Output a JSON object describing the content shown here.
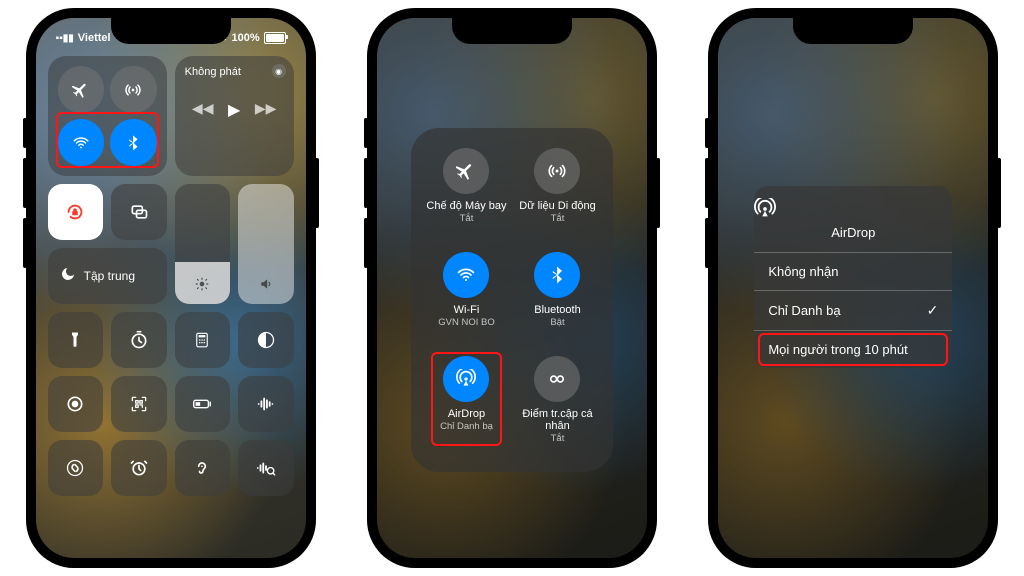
{
  "status": {
    "carrier": "Viettel",
    "battery_pct": "100%"
  },
  "phone1": {
    "media_title": "Không phát",
    "focus_label": "Tập trung"
  },
  "conn_panel": {
    "airplane": {
      "label": "Chế độ Máy bay",
      "sub": "Tắt"
    },
    "cellular": {
      "label": "Dữ liệu Di động",
      "sub": "Tắt"
    },
    "wifi": {
      "label": "Wi-Fi",
      "sub": "GVN NOI BO"
    },
    "bluetooth": {
      "label": "Bluetooth",
      "sub": "Bật"
    },
    "airdrop": {
      "label": "AirDrop",
      "sub": "Chỉ Danh bạ"
    },
    "hotspot": {
      "label": "Điểm tr.cập cá nhân",
      "sub": "Tắt"
    }
  },
  "airdrop_sheet": {
    "title": "AirDrop",
    "opts": {
      "off": "Không nhận",
      "contacts": "Chỉ Danh bạ",
      "everyone": "Mọi người trong 10 phút"
    }
  }
}
